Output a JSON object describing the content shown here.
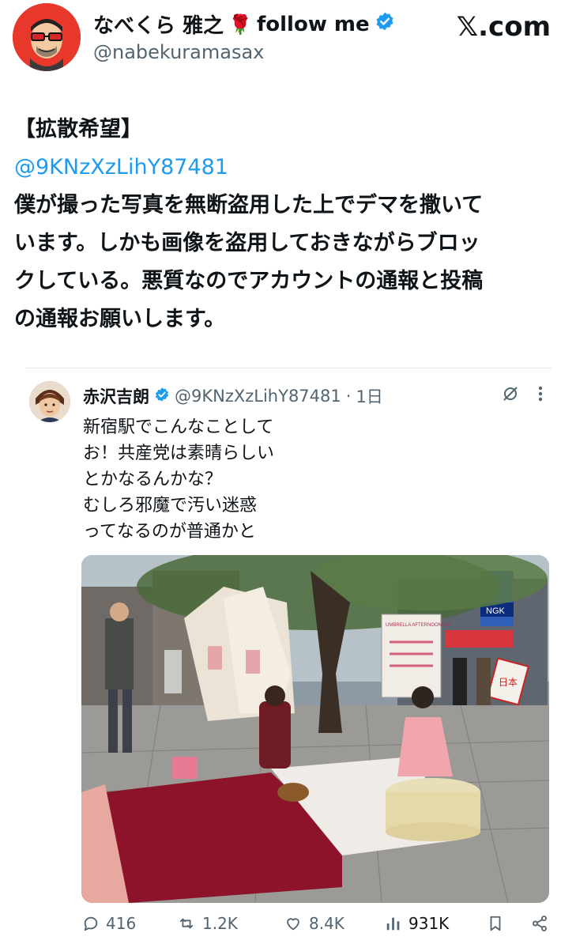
{
  "header": {
    "author_name": "なべくら 雅之",
    "author_suffix": "follow me",
    "rose_emoji": "🌹",
    "author_handle": "@nabekuramasax",
    "site_logo": "𝕏.com"
  },
  "post": {
    "lines": [
      "【拡散希望】",
      "@9KNzXzLihY87481",
      "僕が撮った写真を無断盗用した上でデマを撒いて",
      "います。しかも画像を盗用しておきながらブロッ",
      "クしている。悪質なのでアカウントの通報と投稿",
      "の通報お願いします。"
    ]
  },
  "quote": {
    "name": "赤沢吉朗",
    "handle": "@9KNzXzLihY87481",
    "separator": "·",
    "time": "1日",
    "lines": [
      "新宿駅でこんなことして",
      "お！共産党は素晴らしい",
      "とかなるんかな？",
      "むしろ邪魔で汚い迷惑",
      "ってなるのが普通かと"
    ],
    "image_signs": [
      "UMBRELLA AFTERNOON TEA",
      "日本",
      "NGK"
    ]
  },
  "actions": {
    "replies": "416",
    "reposts": "1.2K",
    "likes": "8.4K",
    "views": "931K"
  },
  "colors": {
    "accent": "#1d9bf0",
    "muted": "#536471",
    "text": "#0f1419",
    "avatar_bg": "#e8382b"
  }
}
